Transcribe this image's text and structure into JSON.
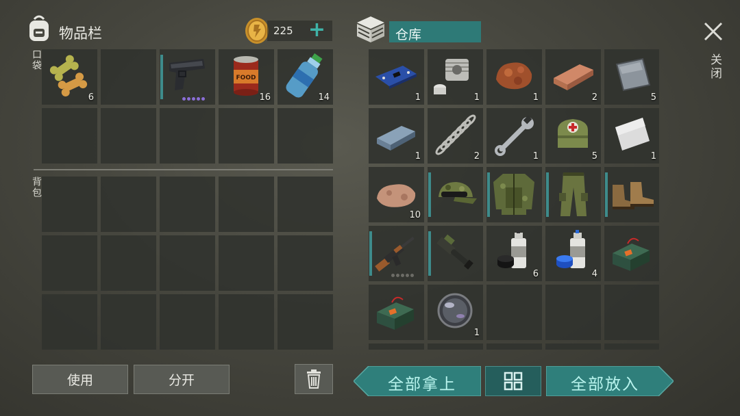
{
  "header": {
    "inventory_title": "物品栏",
    "coins": "225",
    "plus_label": "+",
    "storage_title": "仓库",
    "close_label": "关闭"
  },
  "sections": {
    "pockets": "口袋",
    "backpack": "背包"
  },
  "inventory": {
    "pockets": [
      {
        "item": "dog-biscuits",
        "qty": "6"
      },
      {
        "item": "empty"
      },
      {
        "item": "pistol",
        "qty": "",
        "durability_dots": 5
      },
      {
        "item": "canned-food",
        "qty": "16",
        "can_label": "FOOD"
      },
      {
        "item": "water-bottle",
        "qty": "14"
      },
      {
        "item": "empty"
      },
      {
        "item": "empty"
      },
      {
        "item": "empty"
      },
      {
        "item": "empty"
      },
      {
        "item": "empty"
      }
    ],
    "backpack_slots": 15
  },
  "storage": {
    "items": [
      {
        "item": "circuit-board",
        "qty": "1"
      },
      {
        "item": "engine-part",
        "qty": "1"
      },
      {
        "item": "copper-ore",
        "qty": "1"
      },
      {
        "item": "copper-ingot",
        "qty": "2"
      },
      {
        "item": "metal-plate",
        "qty": "5"
      },
      {
        "item": "iron-ingot",
        "qty": "1"
      },
      {
        "item": "spring",
        "qty": "2"
      },
      {
        "item": "wrench",
        "qty": "1"
      },
      {
        "item": "first-aid-bag",
        "qty": "5"
      },
      {
        "item": "steel-sheet",
        "qty": "1"
      },
      {
        "item": "stone",
        "qty": "10"
      },
      {
        "item": "camo-cap",
        "qty": ""
      },
      {
        "item": "camo-jacket",
        "qty": ""
      },
      {
        "item": "camo-pants",
        "qty": ""
      },
      {
        "item": "boots",
        "qty": ""
      },
      {
        "item": "assault-rifle",
        "qty": ""
      },
      {
        "item": "gun-part",
        "qty": ""
      },
      {
        "item": "spray-paint-black",
        "qty": "6"
      },
      {
        "item": "spray-paint-blue",
        "qty": "4"
      },
      {
        "item": "explosive-box",
        "qty": ""
      },
      {
        "item": "explosive-box",
        "qty": ""
      },
      {
        "item": "lens",
        "qty": "1"
      },
      {
        "item": "empty"
      },
      {
        "item": "empty"
      },
      {
        "item": "empty"
      }
    ]
  },
  "buttons": {
    "use": "使用",
    "split": "分开",
    "take_all": "全部拿上",
    "put_all": "全部放入"
  },
  "colors": {
    "accent_teal": "#2f7f7b",
    "accent_text": "#b9f4ee",
    "rarity_bar": "#3e8b8b",
    "durability_purple": "#8a6ed6"
  }
}
